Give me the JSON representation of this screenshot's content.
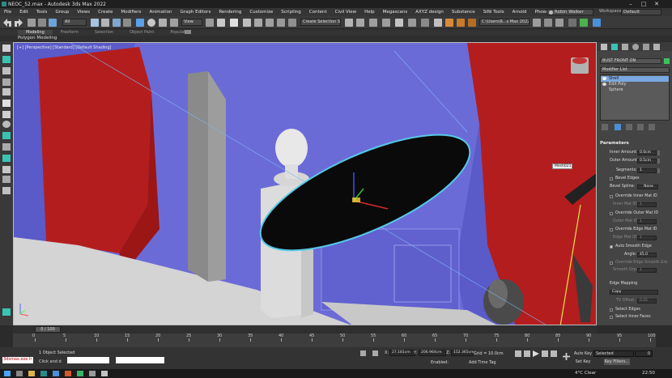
{
  "window": {
    "title": "NEOC_52.max - Autodesk 3ds Max 2022"
  },
  "menu": [
    "File",
    "Edit",
    "Tools",
    "Group",
    "Views",
    "Create",
    "Modifiers",
    "Animation",
    "Graph Editors",
    "Rendering",
    "Customize",
    "Scripting",
    "Content",
    "Civil View",
    "Help",
    "Megascans",
    "AXYZ design",
    "Substance",
    "SiNi Tools",
    "Arnold",
    "Phoenix FD"
  ],
  "user": {
    "name": "Robin Walker",
    "workspace_label": "Workspaces:",
    "workspace_value": "Default"
  },
  "toolbar": {
    "filter": "All",
    "view": "View",
    "selection_set": "Create Selection Se",
    "project_path": "C:\\Users\\R...s Max 2022"
  },
  "ribbon": {
    "tabs": [
      "Modeling",
      "Freeform",
      "Selection",
      "Object Paint",
      "Populate"
    ],
    "active": "Modeling",
    "sub_label": "Polygon Modeling"
  },
  "viewport": {
    "label": "[+] [Perspective] [Standard] [Default Shading]",
    "tooltip": "Mesh021"
  },
  "command_panel": {
    "object_name": "BUST FRONT ON",
    "object_color": "#3ec15d",
    "modifier_list_label": "Modifier List",
    "stack": [
      "Shell",
      "Edit Poly",
      "Sphere"
    ],
    "stack_selected": "Shell",
    "rollout": "Parameters",
    "inner_amount_label": "Inner Amount:",
    "inner_amount": "0.0cm",
    "outer_amount_label": "Outer Amount:",
    "outer_amount": "0.5cm",
    "segments_label": "Segments:",
    "segments": "1",
    "bevel_edges": "Bevel Edges",
    "bevel_spline_label": "Bevel Spline:",
    "bevel_spline": "None",
    "override_inner": "Override Inner Mat ID",
    "inner_mat_label": "Inner Mat ID:",
    "inner_mat": "1",
    "override_outer": "Override Outer Mat ID",
    "outer_mat_label": "Outer Mat ID:",
    "outer_mat": "1",
    "override_edge": "Override Edge Mat ID",
    "edge_mat_label": "Edge Mat ID:",
    "edge_mat": "1",
    "auto_smooth": "Auto Smooth Edge",
    "angle_label": "Angle:",
    "angle": "45.0",
    "override_edge_smooth": "Override Edge Smooth Gro",
    "smooth_grp_label": "Smooth Grp:",
    "smooth_grp": "1",
    "edge_mapping_label": "Edge Mapping",
    "edge_mapping": "Copy",
    "tv_offset_label": "TV Offset:",
    "tv_offset": "0.05",
    "select_edges": "Select Edges",
    "select_inner": "Select Inner Faces"
  },
  "timeline": {
    "slider": "0 / 100",
    "ticks": [
      "0",
      "5",
      "10",
      "15",
      "20",
      "25",
      "30",
      "35",
      "40",
      "45",
      "50",
      "55",
      "60",
      "65",
      "70",
      "75",
      "80",
      "85",
      "90",
      "95",
      "100"
    ]
  },
  "status": {
    "maxscript": "3dsmax.exe Ir",
    "selection": "1 Object Selected",
    "hint": "Click and d",
    "x_label": "X:",
    "x": "27.181cm",
    "y_label": "Y:",
    "y": "206.964cm",
    "z_label": "Z:",
    "z": "152.365cm",
    "grid": "Grid = 10.0cm",
    "enabled": "Enabled:",
    "add_time_tag": "Add Time Tag",
    "auto_key": "Auto Key",
    "set_key": "Set Key",
    "selected": "Selected",
    "key_filters": "Key Filters...",
    "frame": "0"
  },
  "taskbar": {
    "weather": "4°C Clear",
    "time": "22:50"
  }
}
